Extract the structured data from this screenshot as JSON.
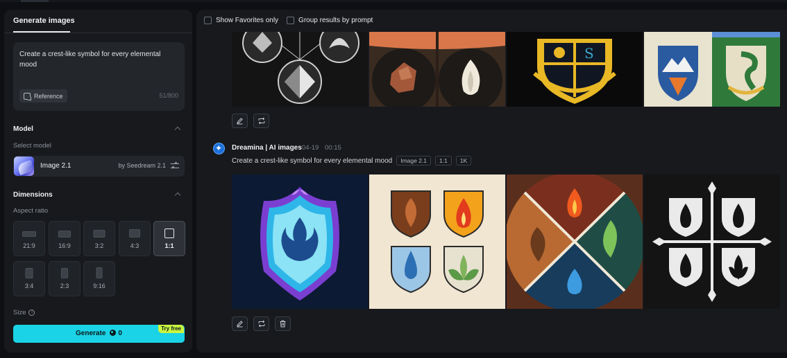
{
  "left_panel": {
    "tab_label": "Generate images",
    "prompt": {
      "text": "Create a crest-like symbol for every elemental mood",
      "reference_label": "Reference",
      "counter": "51/800"
    },
    "model": {
      "section_title": "Model",
      "select_label": "Select model",
      "name": "Image 2.1",
      "provider": "by Seedream 2.1"
    },
    "dimensions": {
      "section_title": "Dimensions",
      "aspect_label": "Aspect ratio",
      "ratios": [
        "21:9",
        "16:9",
        "3:2",
        "4:3",
        "1:1",
        "3:4",
        "2:3",
        "9:16"
      ],
      "selected": "1:1",
      "size_label": "Size"
    },
    "generate": {
      "label": "Generate",
      "cost": "0",
      "badge": "Try free"
    }
  },
  "right_panel": {
    "filters": {
      "favorites_label": "Show Favorites only",
      "group_label": "Group results by prompt"
    },
    "generation": {
      "name": "Dreamina | AI images",
      "date": "04-19",
      "time": "00:15",
      "prompt": "Create a crest-like symbol for every elemental mood",
      "chips": [
        "Image 2.1",
        "1:1",
        "1K"
      ]
    }
  },
  "colors": {
    "accent": "#1ad3e6",
    "badge": "#cbf53e",
    "panel": "#17191d",
    "background": "#0d0f12"
  }
}
